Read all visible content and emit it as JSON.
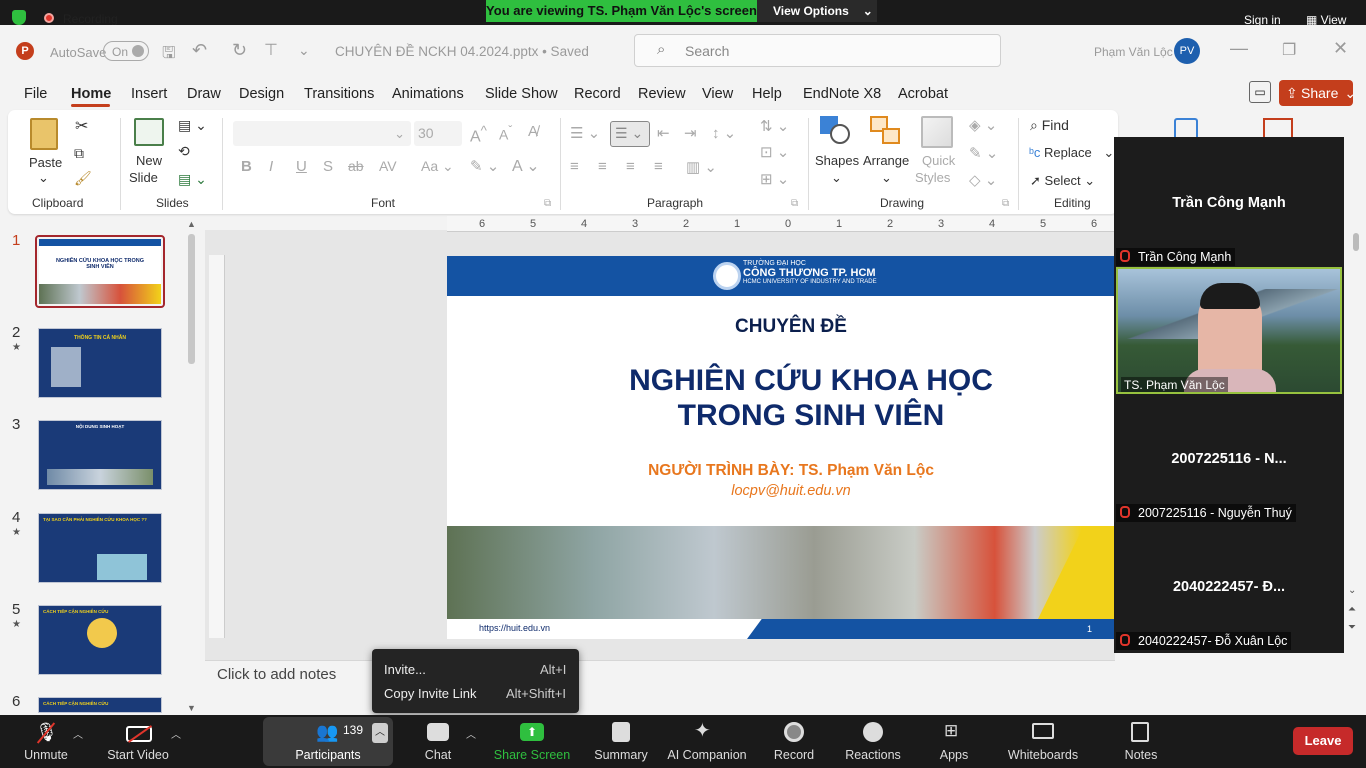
{
  "zoom_top": {
    "recording": "Recording",
    "banner": "You are viewing TS. Phạm Văn Lộc's screen",
    "view_options": "View Options",
    "sign_in": "Sign in",
    "view": "View"
  },
  "ppt": {
    "title": {
      "autosave": "AutoSave",
      "toggle": "On",
      "filename": "CHUYÊN ĐỀ NCKH 04.2024.pptx • Saved",
      "search": "Search",
      "user": "Phạm Văn Lộc",
      "avatar": "PV"
    },
    "menu": [
      "File",
      "Home",
      "Insert",
      "Draw",
      "Design",
      "Transitions",
      "Animations",
      "Slide Show",
      "Record",
      "Review",
      "View",
      "Help",
      "EndNote X8",
      "Acrobat"
    ],
    "share": "Share",
    "ribbon": {
      "paste": "Paste",
      "new_slide_1": "New",
      "new_slide_2": "Slide",
      "font_size": "30",
      "shapes": "Shapes",
      "arrange": "Arrange",
      "quick_styles_1": "Quick",
      "quick_styles_2": "Styles",
      "find": "Find",
      "replace": "Replace",
      "select": "Select",
      "groups": [
        "Clipboard",
        "Slides",
        "Font",
        "Paragraph",
        "Drawing",
        "Editing"
      ]
    },
    "thumbs": [
      "1",
      "2",
      "3",
      "4",
      "5",
      "6"
    ],
    "thumb_titles": [
      "NGHIÊN CỨU KHOA HỌC TRONG SINH VIÊN",
      "THÔNG TIN CÁ NHÂN",
      "NỘI DUNG SINH HOẠT",
      "TẠI SAO CẦN PHẢI NGHIÊN CỨU KHOA HỌC ??",
      "CÁCH TIẾP CẬN NGHIÊN CỨU",
      "CÁCH TIẾP CẬN NGHIÊN CỨU"
    ],
    "ruler": [
      "6",
      "5",
      "4",
      "3",
      "2",
      "1",
      "0",
      "1",
      "2",
      "3",
      "4",
      "5",
      "6"
    ],
    "slide": {
      "uni_1": "TRƯỜNG ĐẠI HỌC",
      "uni_2": "CÔNG THƯƠNG TP. HCM",
      "uni_3": "HCMC UNIVERSITY OF INDUSTRY AND TRADE",
      "topic": "CHUYÊN ĐỀ",
      "title_1": "NGHIÊN CỨU KHOA HỌC",
      "title_2": "TRONG SINH VIÊN",
      "presenter": "NGƯỜI TRÌNH BÀY: TS. Phạm Văn Lộc",
      "email": "locpv@huit.edu.vn",
      "url": "https://huit.edu.vn",
      "page": "1"
    },
    "notes": "Click to add notes"
  },
  "popup": {
    "invite": "Invite...",
    "invite_key": "Alt+I",
    "copy": "Copy Invite Link",
    "copy_key": "Alt+Shift+I"
  },
  "participants": [
    {
      "big": "Trần Công Mạnh",
      "label": "Trần Công Mạnh"
    },
    {
      "video_label": "TS. Phạm Văn Lộc"
    },
    {
      "big": "2007225116 - N...",
      "label": "2007225116 - Nguyễn Thuý"
    },
    {
      "big": "2040222457- Đ...",
      "label": "2040222457- Đỗ Xuân Lộc"
    }
  ],
  "zoom_bar": {
    "unmute": "Unmute",
    "start_video": "Start Video",
    "participants": "Participants",
    "count": "139",
    "chat": "Chat",
    "share_screen": "Share Screen",
    "summary": "Summary",
    "ai": "AI Companion",
    "record": "Record",
    "reactions": "Reactions",
    "apps": "Apps",
    "whiteboards": "Whiteboards",
    "notes": "Notes",
    "leave": "Leave"
  },
  "colors": {
    "zoom_green": "#2fbf3f",
    "ppt_accent": "#c43e1c",
    "slide_blue": "#1453a3",
    "slide_orange": "#e8771e",
    "leave_red": "#c62a2a"
  }
}
